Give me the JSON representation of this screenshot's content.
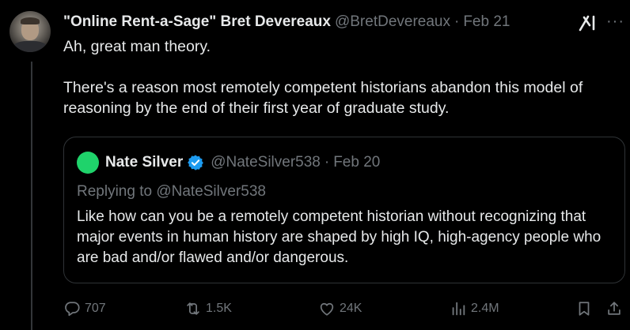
{
  "tweet": {
    "display_name": "\"Online Rent-a-Sage\" Bret Devereaux",
    "handle": "@BretDevereaux",
    "separator": "·",
    "date": "Feb 21",
    "text_lines": [
      "Ah, great man theory.",
      "There's a reason most remotely competent historians abandon this model of reasoning by the end of their first year of graduate study."
    ]
  },
  "quoted_tweet": {
    "display_name": "Nate Silver",
    "handle": "@NateSilver538",
    "separator": "·",
    "date": "Feb 20",
    "replying_to": "Replying to @NateSilver538",
    "text": "Like how can you be a remotely competent historian without recognizing that major events in human history are shaped by high IQ, high-agency people who are bad and/or flawed and/or dangerous."
  },
  "actions": {
    "replies": "707",
    "reposts": "1.5K",
    "likes": "24K",
    "views": "2.4M"
  },
  "icons": {
    "grok": "grok-icon",
    "more": "more-icon",
    "verified": "verified-badge-icon",
    "reply": "reply-icon",
    "repost": "repost-icon",
    "like": "heart-icon",
    "views": "views-icon",
    "bookmark": "bookmark-icon",
    "share": "share-icon"
  },
  "colors": {
    "background": "#000000",
    "text": "#e7e9ea",
    "muted": "#71767b",
    "border": "#2f3336",
    "verified": "#1d9bf0",
    "quote_avatar": "#1fd36b"
  }
}
